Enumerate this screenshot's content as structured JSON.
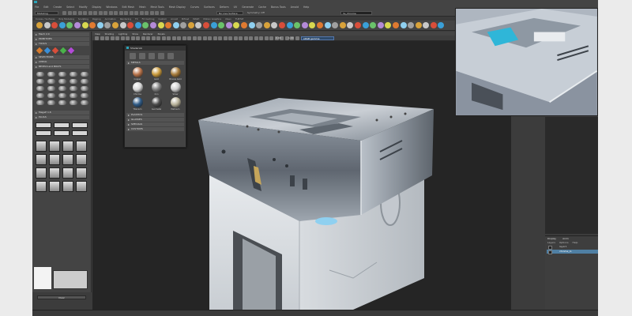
{
  "menubar": {
    "items": [
      "File",
      "Edit",
      "Create",
      "Select",
      "Modify",
      "Display",
      "Windows",
      "Edit Mesh",
      "Mesh",
      "Mesh Tools",
      "Mesh Display",
      "Curves",
      "Surfaces",
      "Deform",
      "UV",
      "Generate",
      "Cache",
      "Bonus Tools",
      "Arnold",
      "Help"
    ]
  },
  "status": {
    "mode": "Modeling",
    "surface_select": "No Live Surface",
    "symmetry": "Symmetry: Off",
    "name_field": "hs_Chrome"
  },
  "shelf": {
    "tabs": [
      "Curves / Surfaces",
      "Poly Modeling",
      "Sculpting",
      "Rigging",
      "Animation",
      "Rendering",
      "FX",
      "FX Caching",
      "Custom",
      "Arnold",
      "Bifrost",
      "MASH",
      "Motion Graphics",
      "XGen",
      "TURTLE"
    ]
  },
  "toolpanel": {
    "title": "Mech 2.0",
    "sections": [
      "PRIMITIVES",
      "TOOLS",
      "SELECTIONS",
      "CHECK",
      "BEVELS and BOLTS",
      "PLUGS"
    ],
    "plugin_label": "MegaP 1.6",
    "clear_label": "Clear"
  },
  "viewport": {
    "menu": [
      "View",
      "Shading",
      "Lighting",
      "Show",
      "Renderer",
      "Panels"
    ],
    "value_a": "0.00",
    "value_b": "1.00",
    "color_space": "sRGB gamma"
  },
  "material_window": {
    "title": "ShaderLib",
    "section": "METALS",
    "materials": [
      {
        "name": "Copper",
        "color": "#b8734a"
      },
      {
        "name": "Gold",
        "color": "#c99a3c"
      },
      {
        "name": "Bronze Gold",
        "color": "#a57a3a"
      },
      {
        "name": "Chrome",
        "color": "#d8d8d8"
      },
      {
        "name": "Iron",
        "color": "#7c7c7c"
      },
      {
        "name": "Silver",
        "color": "#cfcfcf"
      },
      {
        "name": "Titanium",
        "color": "#2f5a85"
      },
      {
        "name": "Gunmetal",
        "color": "#4a4a4a"
      },
      {
        "name": "Platinum",
        "color": "#b8b29a"
      }
    ],
    "collapsed": [
      "PLASTICS",
      "GLASSES",
      "SPECIALS",
      "CUSTOMS"
    ]
  },
  "layers": {
    "tabs": [
      "Display",
      "Anim"
    ],
    "menu": [
      "Layers",
      "Options",
      "Help"
    ],
    "rows": [
      "layer1",
      "chrome_lo"
    ]
  },
  "colors": {
    "accent": "#2aa3b8",
    "selection": "#4f7fa3",
    "chrome": "#c8ccd2",
    "plastic": "#e4e7ea"
  }
}
